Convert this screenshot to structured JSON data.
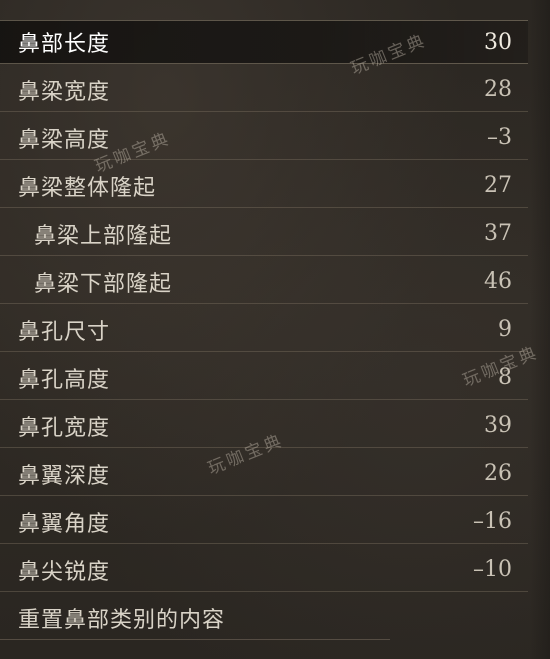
{
  "nose_settings": {
    "rows": [
      {
        "label": "鼻部长度",
        "value": "30"
      },
      {
        "label": "鼻梁宽度",
        "value": "28"
      },
      {
        "label": "鼻梁高度",
        "value": "–3"
      },
      {
        "label": "鼻梁整体隆起",
        "value": "27"
      },
      {
        "label": "鼻梁上部隆起",
        "value": "37"
      },
      {
        "label": "鼻梁下部隆起",
        "value": "46"
      },
      {
        "label": "鼻孔尺寸",
        "value": "9"
      },
      {
        "label": "鼻孔高度",
        "value": "8"
      },
      {
        "label": "鼻孔宽度",
        "value": "39"
      },
      {
        "label": "鼻翼深度",
        "value": "26"
      },
      {
        "label": "鼻翼角度",
        "value": "–16"
      },
      {
        "label": "鼻尖锐度",
        "value": "–10"
      }
    ],
    "reset_label": "重置鼻部类别的内容"
  },
  "watermark": {
    "text": "玩咖宝典"
  }
}
